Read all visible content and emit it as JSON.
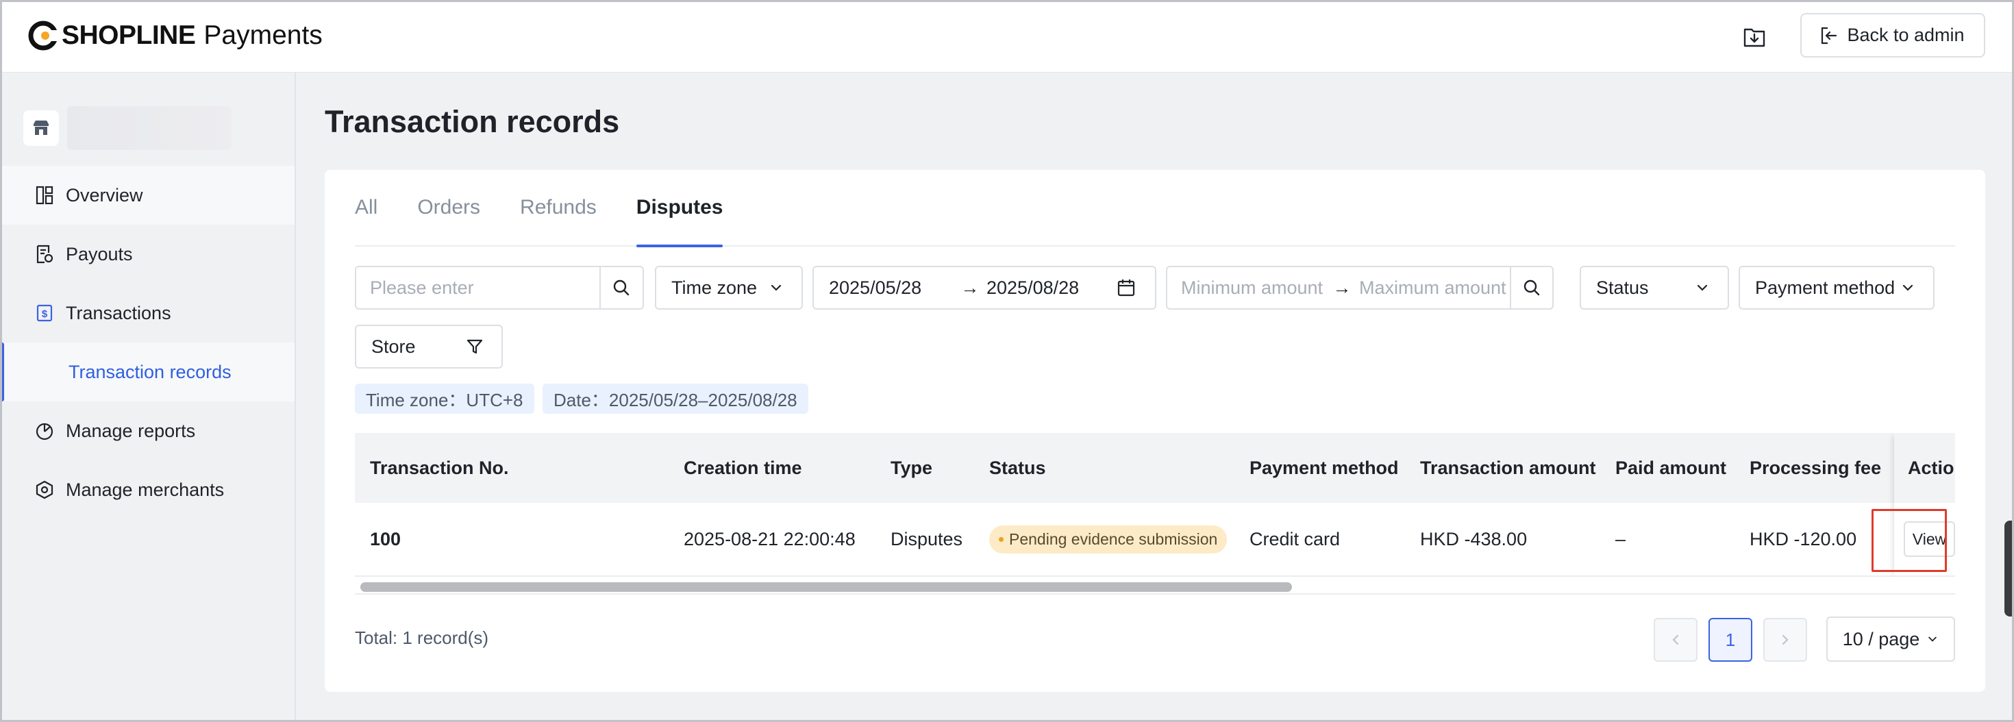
{
  "header": {
    "brand": "SHOPLINE",
    "product": "Payments",
    "export_icon": "download-icon",
    "back_label": "Back to admin"
  },
  "sidebar": {
    "items": [
      {
        "label": "Overview",
        "icon": "dashboard-icon"
      },
      {
        "label": "Payouts",
        "icon": "payout-icon"
      },
      {
        "label": "Transactions",
        "icon": "dollar-icon"
      },
      {
        "label": "Transaction records",
        "icon": ""
      },
      {
        "label": "Manage reports",
        "icon": "pie-chart-icon"
      },
      {
        "label": "Manage merchants",
        "icon": "hexagon-icon"
      }
    ]
  },
  "page": {
    "title": "Transaction records"
  },
  "tabs": [
    "All",
    "Orders",
    "Refunds",
    "Disputes"
  ],
  "active_tab": "Disputes",
  "filters": {
    "search_placeholder": "Please enter",
    "time_zone_label": "Time zone",
    "date_start": "2025/05/28",
    "date_end": "2025/08/28",
    "date_arrow": "→",
    "min_amount_placeholder": "Minimum amount",
    "max_amount_placeholder": "Maximum amount",
    "status_label": "Status",
    "payment_method_label": "Payment method",
    "store_label": "Store"
  },
  "applied_tags": [
    "Time zone：UTC+8",
    "Date：2025/05/28–2025/08/28"
  ],
  "table": {
    "columns": [
      "Transaction No.",
      "Creation time",
      "Type",
      "Status",
      "Payment method",
      "Transaction amount",
      "Paid amount",
      "Processing fee",
      "Action"
    ],
    "rows": [
      {
        "transaction_no": "100",
        "creation_time": "2025-08-21 22:00:48",
        "type": "Disputes",
        "status": "Pending evidence submission",
        "payment_method": "Credit card",
        "transaction_amount": "HKD -438.00",
        "paid_amount": "–",
        "processing_fee": "HKD -120.00",
        "action": "View"
      }
    ]
  },
  "pagination": {
    "total": "Total: 1 record(s)",
    "current_page": "1",
    "per_page": "10 / page"
  },
  "colors": {
    "accent": "#3b63e3",
    "status_badge_bg": "#fdebc8",
    "highlight": "#e03b2a"
  }
}
